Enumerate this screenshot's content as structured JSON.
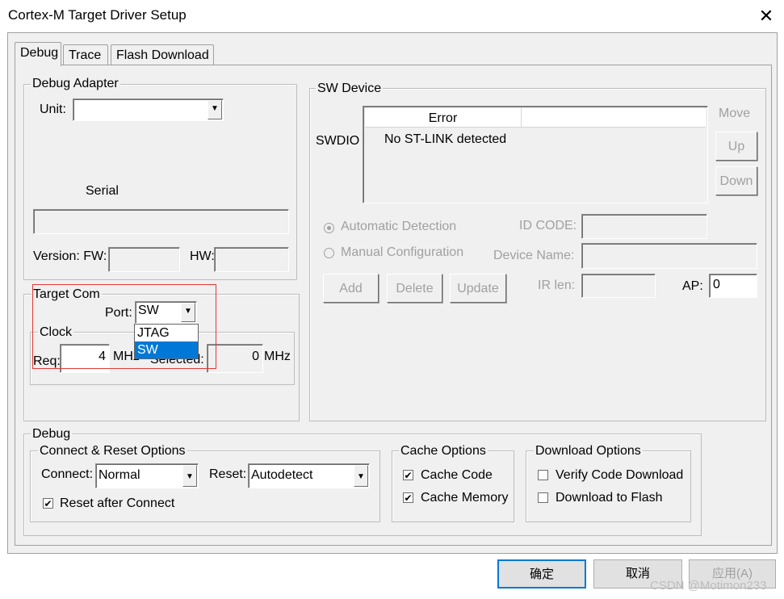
{
  "window": {
    "title": "Cortex-M Target Driver Setup",
    "close_glyph": "✕"
  },
  "tabs": [
    {
      "label": "Debug",
      "active": true
    },
    {
      "label": "Trace",
      "active": false
    },
    {
      "label": "Flash Download",
      "active": false
    }
  ],
  "debug_adapter": {
    "legend": "Debug Adapter",
    "unit_label": "Unit:",
    "unit_value": "",
    "serial_label": "Serial",
    "serial_value": "",
    "version_fw_label": "Version: FW:",
    "version_fw_value": "",
    "hw_label": "HW:",
    "hw_value": ""
  },
  "target_com": {
    "legend": "Target Com",
    "port_label": "Port:",
    "port_value": "SW",
    "port_options": [
      "JTAG",
      "SW"
    ],
    "port_selected": "SW",
    "clock_legend": "Clock",
    "req_label": "Req:",
    "req_value": "4",
    "req_unit": "MHz",
    "selected_label": "Selected:",
    "selected_value": "0",
    "selected_unit": "MHz"
  },
  "sw_device": {
    "legend": "SW Device",
    "swdio_label": "SWDIO",
    "table_header": "Error",
    "table_row": "No ST-LINK detected",
    "move_label": "Move",
    "up_button": "Up",
    "down_button": "Down",
    "auto_detection": "Automatic Detection",
    "manual_config": "Manual Configuration",
    "id_code_label": "ID CODE:",
    "id_code_value": "",
    "device_name_label": "Device Name:",
    "device_name_value": "",
    "add_button": "Add",
    "delete_button": "Delete",
    "update_button": "Update",
    "ir_len_label": "IR len:",
    "ir_len_value": "",
    "ap_label": "AP:",
    "ap_value": "0"
  },
  "debug_section": {
    "legend": "Debug",
    "connect_reset": {
      "legend": "Connect & Reset Options",
      "connect_label": "Connect:",
      "connect_value": "Normal",
      "reset_label": "Reset:",
      "reset_value": "Autodetect",
      "reset_after_connect": "Reset after Connect",
      "reset_after_connect_checked": true
    },
    "cache_options": {
      "legend": "Cache Options",
      "cache_code": "Cache Code",
      "cache_code_checked": true,
      "cache_memory": "Cache Memory",
      "cache_memory_checked": true
    },
    "download_options": {
      "legend": "Download Options",
      "verify_code": "Verify Code Download",
      "verify_code_checked": false,
      "download_flash": "Download to Flash",
      "download_flash_checked": false
    }
  },
  "footer": {
    "ok_button": "确定",
    "cancel_button": "取消",
    "apply_button": "应用(A)",
    "watermark": "CSDN @Motimon233"
  },
  "colors": {
    "dialog_bg": "#f0f0f0",
    "highlight": "#0078d7",
    "annotation_red": "#e53935",
    "disabled_text": "#a0a0a0"
  }
}
